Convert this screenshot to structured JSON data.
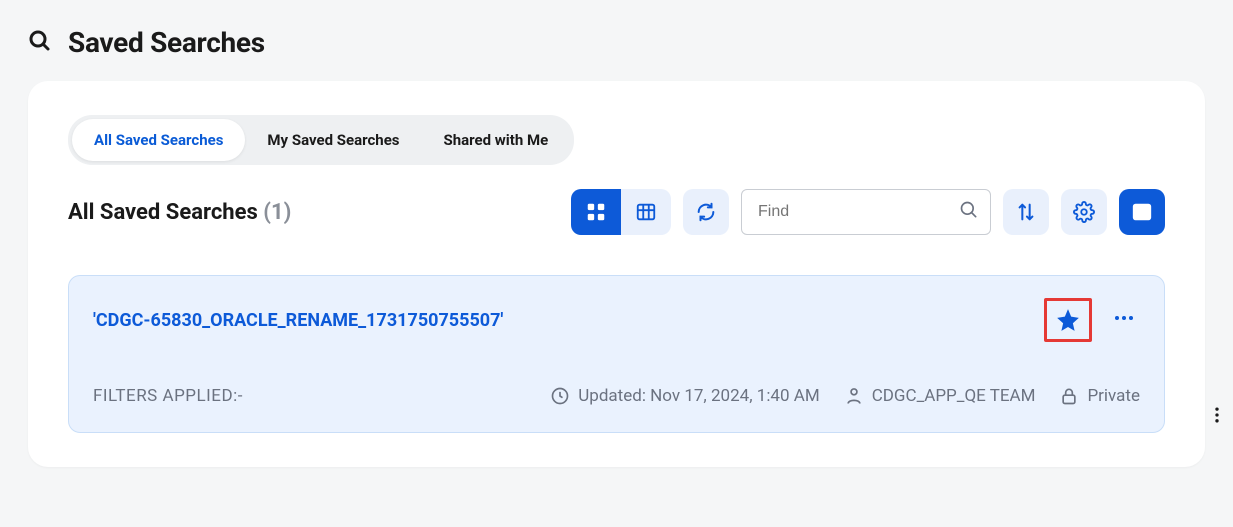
{
  "header": {
    "title": "Saved Searches"
  },
  "tabs": [
    {
      "label": "All Saved Searches",
      "active": true
    },
    {
      "label": "My Saved Searches",
      "active": false
    },
    {
      "label": "Shared with Me",
      "active": false
    }
  ],
  "section": {
    "title_prefix": "All Saved Searches",
    "count": "(1)"
  },
  "toolbar": {
    "find_placeholder": "Find"
  },
  "results": [
    {
      "title": "'CDGC-65830_ORACLE_RENAME_1731750755507'",
      "filters_label": "FILTERS APPLIED:-",
      "updated_label": "Updated: Nov 17, 2024, 1:40 AM",
      "owner": "CDGC_APP_QE TEAM",
      "visibility": "Private",
      "starred": true
    }
  ]
}
